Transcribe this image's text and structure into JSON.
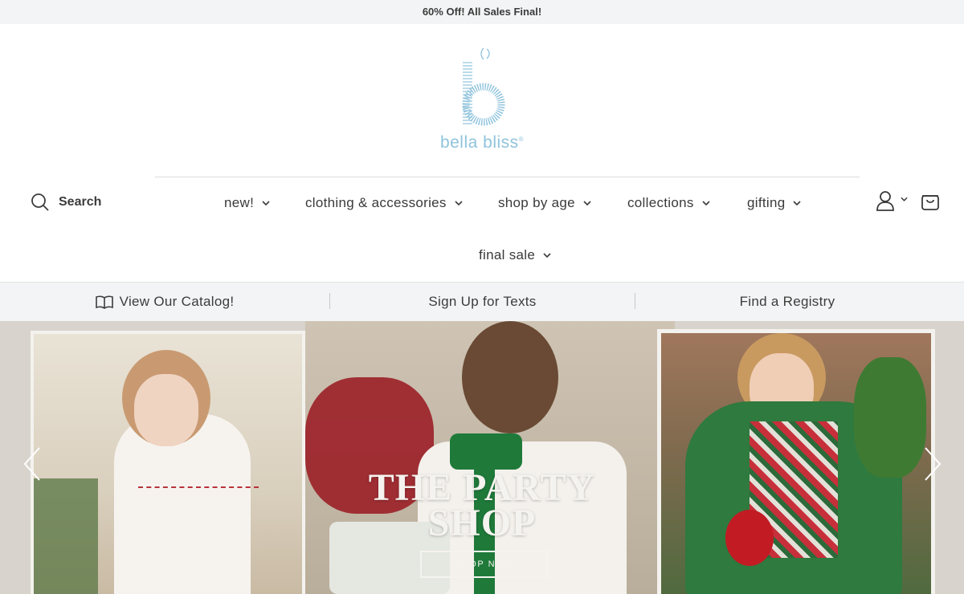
{
  "announcement": "60% Off! All Sales Final!",
  "brand": {
    "name": "bella bliss",
    "mark": "®",
    "color": "#8fc3dc"
  },
  "search": {
    "label": "Search",
    "icon": "search-icon"
  },
  "nav": {
    "items": [
      {
        "label": "new!"
      },
      {
        "label": "clothing & accessories"
      },
      {
        "label": "shop by age"
      },
      {
        "label": "collections"
      },
      {
        "label": "gifting"
      },
      {
        "label": "final sale"
      }
    ]
  },
  "header_icons": {
    "account": "user-icon",
    "cart": "shopping-bag-icon"
  },
  "subbar": {
    "catalog": "View Our Catalog!",
    "texts": "Sign Up for Texts",
    "registry": "Find a Registry"
  },
  "hero": {
    "title_line1": "THE PARTY",
    "title_line2": "SHOP",
    "cta": "SHOP NOW"
  }
}
